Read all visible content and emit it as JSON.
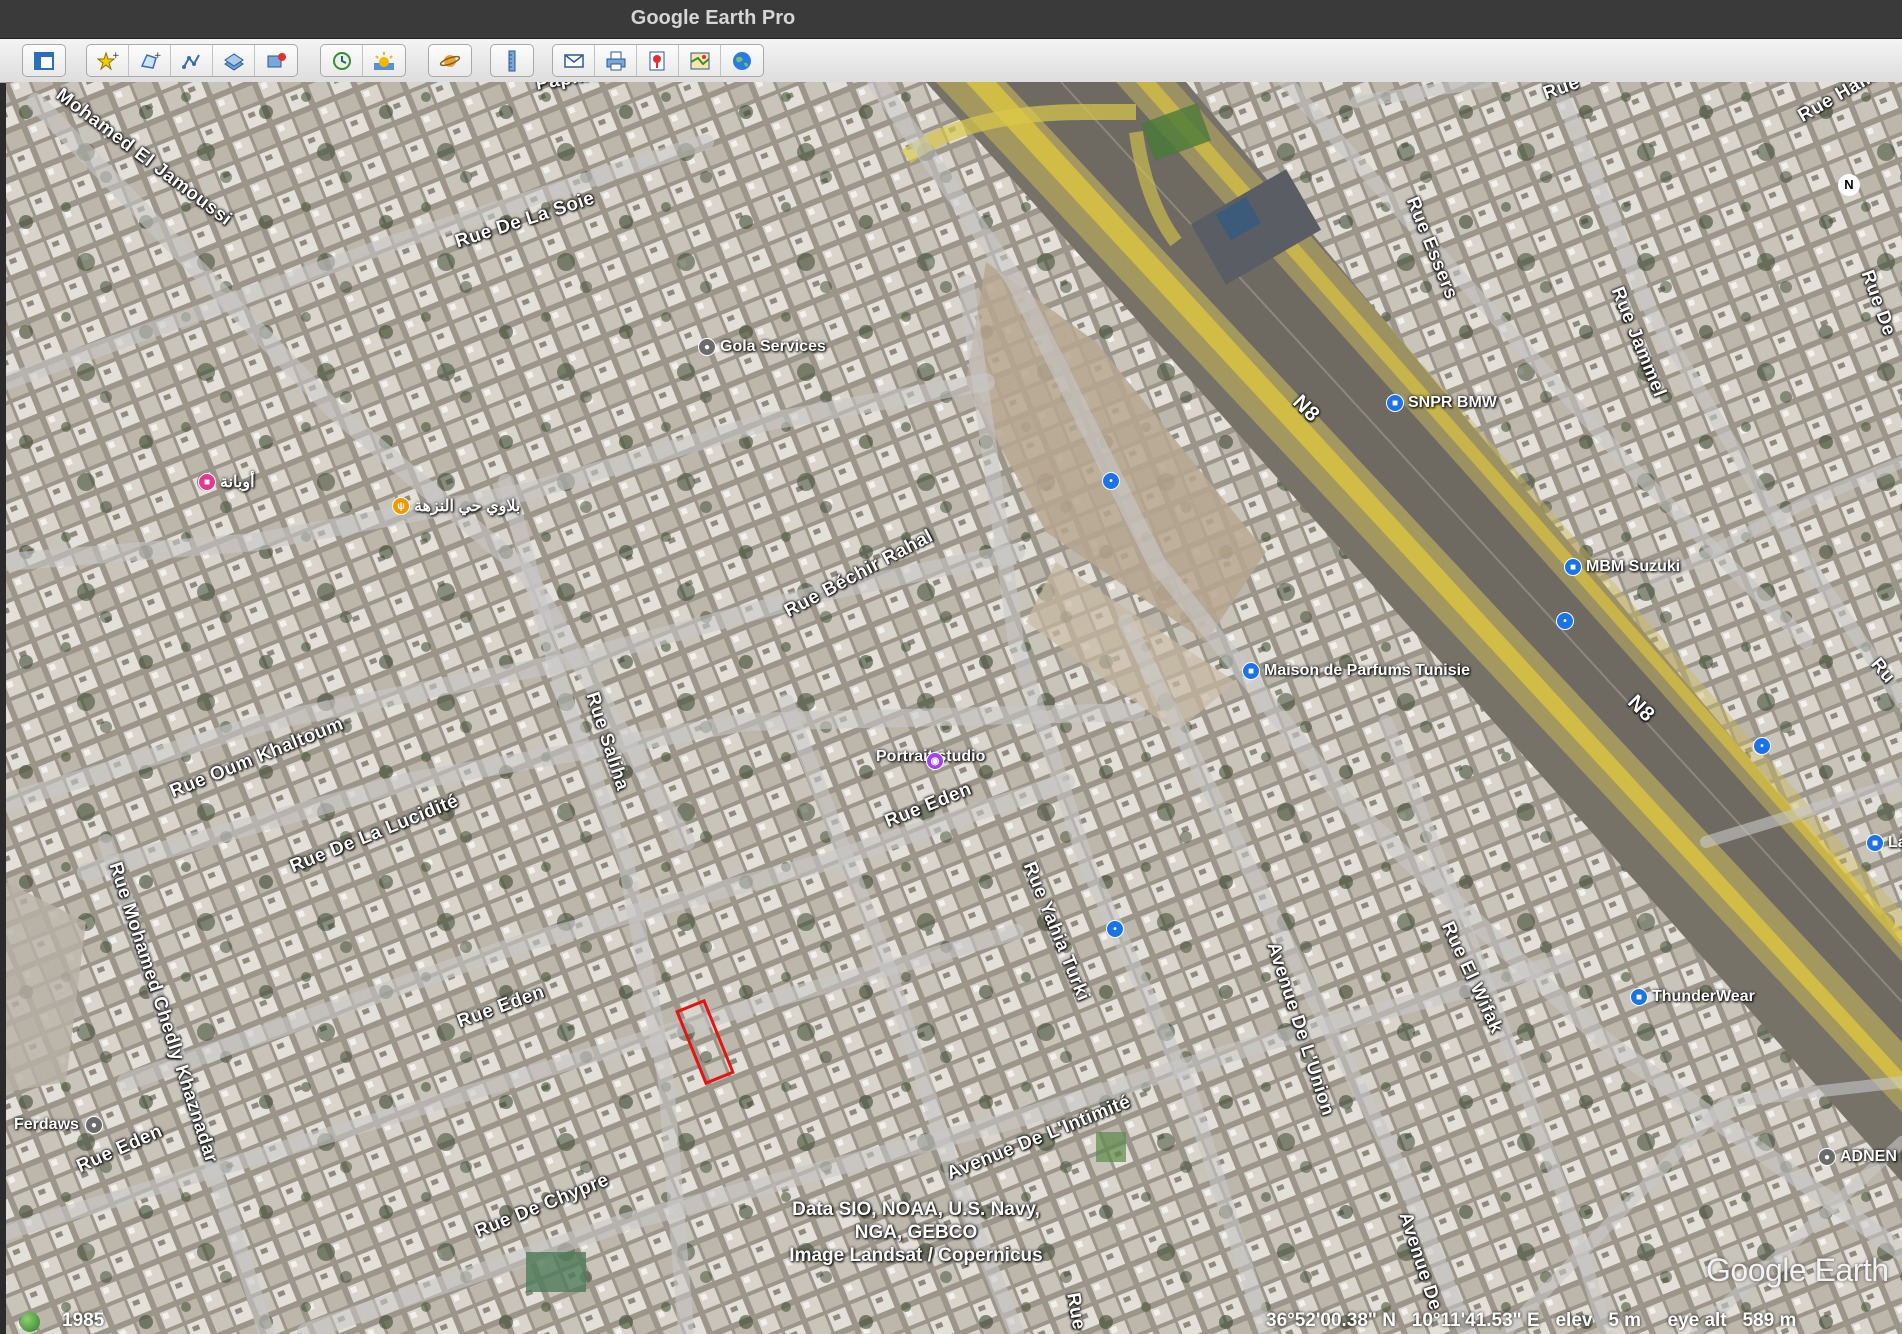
{
  "window": {
    "title": "Google Earth Pro"
  },
  "toolbar": {
    "buttons": [
      {
        "name": "sidebar-toggle-icon"
      },
      {
        "name": "add-placemark-icon"
      },
      {
        "name": "add-polygon-icon"
      },
      {
        "name": "add-path-icon"
      },
      {
        "name": "add-image-overlay-icon"
      },
      {
        "name": "record-tour-icon"
      },
      {
        "name": "historical-imagery-icon"
      },
      {
        "name": "sunlight-icon"
      },
      {
        "name": "switch-planet-icon"
      },
      {
        "name": "ruler-icon"
      },
      {
        "name": "email-icon"
      },
      {
        "name": "print-icon"
      },
      {
        "name": "save-image-icon"
      },
      {
        "name": "view-in-maps-icon"
      },
      {
        "name": "earth-icon"
      }
    ]
  },
  "map": {
    "road_labels": [
      {
        "id": "mohamed-el-jamoussi",
        "text": "Mohamed El Jamoussi"
      },
      {
        "id": "papillon",
        "text": "Papillon"
      },
      {
        "id": "rue-de-la-soie",
        "text": "Rue De La Soie"
      },
      {
        "id": "rue-bechir-rahal",
        "text": "Rue Béchir Rahal"
      },
      {
        "id": "rue-oum-khaltoum",
        "text": "Rue Oum Khaltoum"
      },
      {
        "id": "rue-de-la-lucidite",
        "text": "Rue De La Lucidité"
      },
      {
        "id": "rue-saliha",
        "text": "Rue Saliha"
      },
      {
        "id": "rue-eden-1",
        "text": "Rue Eden"
      },
      {
        "id": "rue-eden-2",
        "text": "Rue Eden"
      },
      {
        "id": "rue-eden-3",
        "text": "Rue Eden"
      },
      {
        "id": "rue-mohamed-chedly-khaznadar",
        "text": "Rue Mohamed Chedly Khaznadar"
      },
      {
        "id": "rue-de-chypre",
        "text": "Rue De Chypre"
      },
      {
        "id": "avenue-de-l-intimite",
        "text": "Avenue De L'Intimité"
      },
      {
        "id": "rue-yahia-turki",
        "text": "Rue Yahia Turki"
      },
      {
        "id": "avenue-de-l-union",
        "text": "Avenue De L'Union"
      },
      {
        "id": "rue-el-wifak",
        "text": "Rue El Wifak"
      },
      {
        "id": "avenue-de",
        "text": "Avenue De"
      },
      {
        "id": "rue-bottom",
        "text": "Rue"
      },
      {
        "id": "rue-essers",
        "text": "Rue Essers"
      },
      {
        "id": "rue-jammel",
        "text": "Rue Jammel"
      },
      {
        "id": "n8-1",
        "text": "N8"
      },
      {
        "id": "n8-2",
        "text": "N8"
      },
      {
        "id": "rue-top",
        "text": "Rue"
      },
      {
        "id": "rue-hamza",
        "text": "Rue Hamza"
      },
      {
        "id": "rue-de-right",
        "text": "Rue De"
      },
      {
        "id": "ru-right",
        "text": "Ru"
      }
    ],
    "pois": [
      {
        "id": "gola-services",
        "text": "Gola Services",
        "color": "#6b6b6b"
      },
      {
        "id": "snpr-bmw",
        "text": "SNPR BMW",
        "color": "#1a73e8"
      },
      {
        "id": "mbm-suzuki",
        "text": "MBM Suzuki",
        "color": "#1a73e8"
      },
      {
        "id": "maison-de-parfums",
        "text": "Maison de Parfums Tunisie",
        "color": "#1a73e8"
      },
      {
        "id": "portrait-studio",
        "text": "Portrait studio",
        "color": "#a142f4"
      },
      {
        "id": "arabic-restaurant",
        "text": "بلاوي حي النزهة",
        "color": "#f29900"
      },
      {
        "id": "arabic-store",
        "text": "أوبانة",
        "color": "#e8368f"
      },
      {
        "id": "thunderwear",
        "text": "ThunderWear",
        "color": "#1a73e8"
      },
      {
        "id": "adnen",
        "text": "ADNEN I",
        "color": "#6b6b6b"
      },
      {
        "id": "ferdaws",
        "text": "Ferdaws",
        "color": "#6b6b6b"
      },
      {
        "id": "la-right",
        "text": "La",
        "color": "#1a73e8"
      }
    ],
    "credits": [
      "Data SIO, NOAA, U.S. Navy, NGA, GEBCO",
      "Image Landsat / Copernicus"
    ],
    "logo": "Google Earth",
    "north_label": "N"
  },
  "status": {
    "year": "1985",
    "lat": "36°52'00.38\" N",
    "lon": "10°11'41.53\" E",
    "elev_label": "elev",
    "elev": "5 m",
    "eye_alt_label": "eye alt",
    "eye_alt": "589 m"
  }
}
